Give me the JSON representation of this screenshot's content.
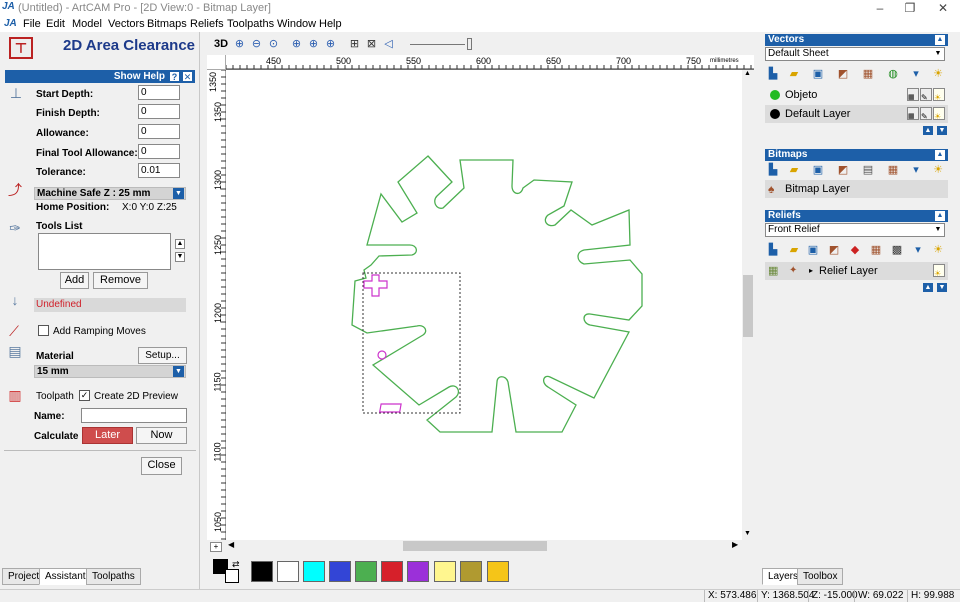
{
  "window": {
    "title": "(Untitled) - ArtCAM Pro - [2D View:0 - Bitmap Layer]",
    "logo_text": "JA"
  },
  "menu": [
    "File",
    "Edit",
    "Model",
    "Vectors",
    "Bitmaps",
    "Reliefs",
    "Toolpaths",
    "Window",
    "Help"
  ],
  "left": {
    "title": "2D Area Clearance",
    "show_help": "Show Help",
    "fields": [
      {
        "label": "Start Depth:",
        "value": "0"
      },
      {
        "label": "Finish Depth:",
        "value": "0"
      },
      {
        "label": "Allowance:",
        "value": "0"
      },
      {
        "label": "Final Tool Allowance:",
        "value": "0"
      },
      {
        "label": "Tolerance:",
        "value": "0.01"
      }
    ],
    "machine_safe_z": "Machine Safe Z : 25 mm",
    "home_position_label": "Home Position:",
    "home_position_value": "X:0 Y:0 Z:25",
    "tools_list": "Tools List",
    "add": "Add",
    "remove": "Remove",
    "undefined": "Undefined",
    "ramping": "Add Ramping Moves",
    "ramping_checked": false,
    "material": "Material",
    "setup": "Setup...",
    "material_value": "15 mm",
    "toolpath": "Toolpath",
    "create_preview": "Create 2D Preview",
    "create_preview_checked": true,
    "name": "Name:",
    "name_value": "",
    "calculate": "Calculate",
    "later": "Later",
    "now": "Now",
    "close": "Close",
    "tabs": [
      "Project",
      "Assistant",
      "Toolpaths"
    ],
    "active_tab": "Assistant"
  },
  "view": {
    "toolbar_3d": "3D",
    "ruler_top": [
      "450",
      "500",
      "550",
      "600",
      "650",
      "700",
      "750"
    ],
    "ruler_unit": "millimetres",
    "ruler_left": [
      "1350",
      "1300",
      "1250",
      "1200",
      "1150",
      "1100",
      "1050"
    ],
    "palette": [
      "#000000",
      "#ffffff",
      "#00ffff",
      "#3345d6",
      "#4caf50",
      "#d6202a",
      "#9b30d9",
      "#fff68f",
      "#b09a30",
      "#f5c518"
    ],
    "vector_color": "#4caf50",
    "bitmap_color": "#cc33cc"
  },
  "right": {
    "vectors_header": "Vectors",
    "vectors_sheet": "Default Sheet",
    "layers": [
      {
        "name": "Objeto",
        "color": "#22bb22"
      },
      {
        "name": "Default Layer",
        "color": "#000000"
      }
    ],
    "bitmaps_header": "Bitmaps",
    "bitmap_layer": "Bitmap Layer",
    "reliefs_header": "Reliefs",
    "relief_select": "Front Relief",
    "relief_layer": "Relief Layer",
    "tabs": [
      "Layers",
      "Toolbox"
    ]
  },
  "status": {
    "x": "X: 573.486",
    "y": "Y: 1368.504",
    "z": "Z: -15.000",
    "w": "W: 69.022",
    "h": "H: 99.988"
  }
}
